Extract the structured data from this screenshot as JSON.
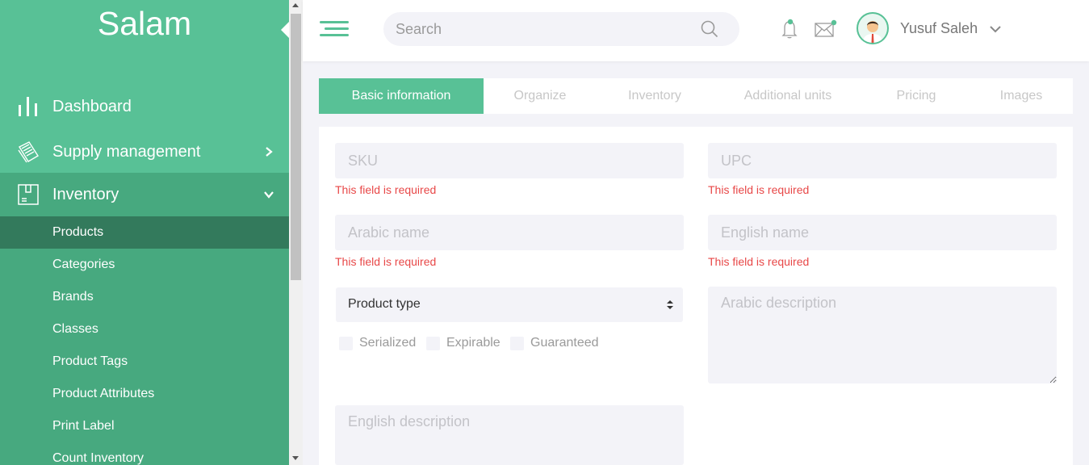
{
  "app": {
    "brand": "Salam"
  },
  "sidebar": {
    "items": [
      {
        "label": "Dashboard"
      },
      {
        "label": "Supply management"
      },
      {
        "label": "Inventory"
      }
    ],
    "inventory_sub": [
      {
        "label": "Products"
      },
      {
        "label": "Categories"
      },
      {
        "label": "Brands"
      },
      {
        "label": "Classes"
      },
      {
        "label": "Product Tags"
      },
      {
        "label": "Product Attributes"
      },
      {
        "label": "Print Label"
      },
      {
        "label": "Count Inventory"
      }
    ]
  },
  "header": {
    "search_placeholder": "Search",
    "user_name": "Yusuf Saleh"
  },
  "tabs": [
    {
      "label": "Basic information",
      "active": true
    },
    {
      "label": "Organize"
    },
    {
      "label": "Inventory"
    },
    {
      "label": "Additional units"
    },
    {
      "label": "Pricing"
    },
    {
      "label": "Images"
    }
  ],
  "form": {
    "sku_placeholder": "SKU",
    "upc_placeholder": "UPC",
    "arabic_name_placeholder": "Arabic name",
    "english_name_placeholder": "English name",
    "required_msg": "This field is required",
    "product_type": "Product type",
    "arabic_desc_placeholder": "Arabic description",
    "english_desc_placeholder": "English description",
    "checkboxes": [
      {
        "label": "Serialized"
      },
      {
        "label": "Expirable"
      },
      {
        "label": "Guaranteed"
      }
    ]
  },
  "colors": {
    "accent": "#58c196",
    "sidebar_sub": "#47a97f",
    "sidebar_active": "#337a5c",
    "error": "#e84848"
  }
}
